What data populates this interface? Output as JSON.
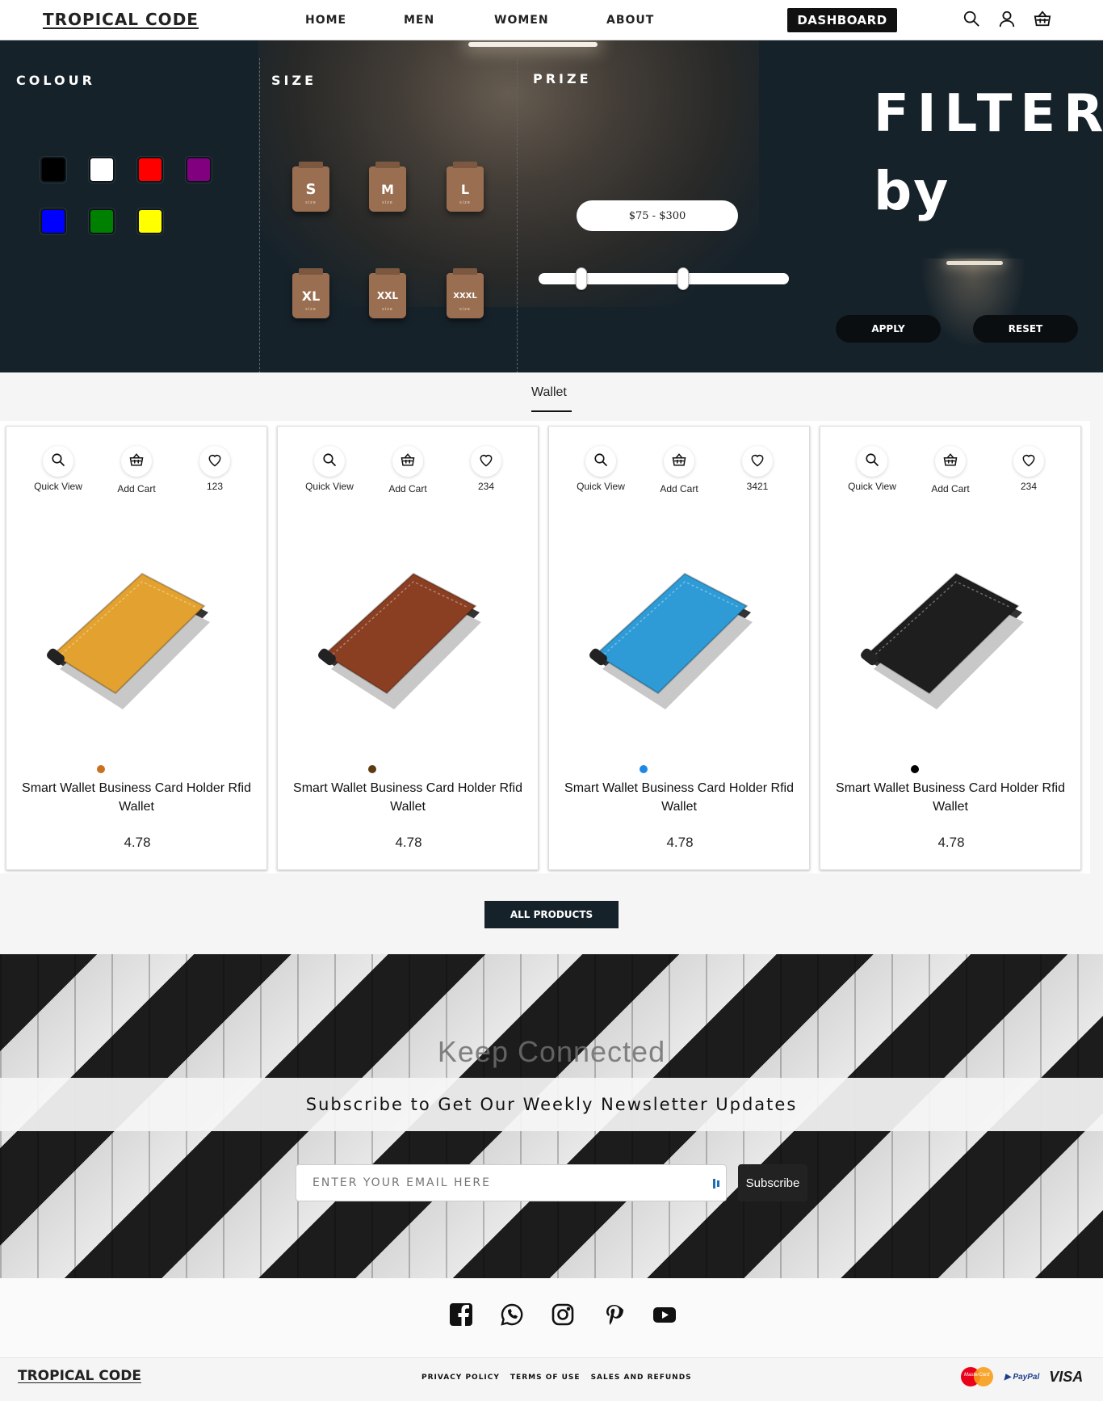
{
  "header": {
    "logo": "TROPICAL CODE",
    "nav": [
      "HOME",
      "MEN",
      "WOMEN",
      "ABOUT"
    ],
    "dashboard_label": "DASHBOARD",
    "icons": [
      "search-icon",
      "user-icon",
      "basket-icon"
    ]
  },
  "filter": {
    "colour_title": "COLOUR",
    "size_title": "SIZE",
    "prize_title": "PRIZE",
    "colours": [
      "#000000",
      "#ffffff",
      "#ff0000",
      "#800080",
      "#0000ff",
      "#008000",
      "#ffff00"
    ],
    "sizes": [
      "S",
      "M",
      "L",
      "XL",
      "XXL",
      "XXXL"
    ],
    "price_range": "$75 - $300",
    "heading_line1": "FILTER",
    "heading_line2": "by",
    "apply_label": "APPLY",
    "reset_label": "RESET"
  },
  "category": {
    "active": "Wallet"
  },
  "products": [
    {
      "quick_view": "Quick View",
      "add_cart": "Add Cart",
      "likes": "123",
      "title": "Smart Wallet Business Card Holder Rfid Wallet",
      "price": "4.78",
      "color": "#c9711f",
      "wallet_color": "#e3a22f"
    },
    {
      "quick_view": "Quick View",
      "add_cart": "Add Cart",
      "likes": "234",
      "title": "Smart Wallet Business Card Holder Rfid Wallet",
      "price": "4.78",
      "color": "#5c3a12",
      "wallet_color": "#8a3f22"
    },
    {
      "quick_view": "Quick View",
      "add_cart": "Add Cart",
      "likes": "3421",
      "title": "Smart Wallet Business Card Holder Rfid Wallet",
      "price": "4.78",
      "color": "#1e88e5",
      "wallet_color": "#2e9bd6"
    },
    {
      "quick_view": "Quick View",
      "add_cart": "Add Cart",
      "likes": "234",
      "title": "Smart Wallet Business Card Holder Rfid Wallet",
      "price": "4.78",
      "color": "#000000",
      "wallet_color": "#1e1e1e"
    }
  ],
  "all_products_label": "ALL PRODUCTS",
  "newsletter": {
    "title": "Keep Connected",
    "subtitle": "Subscribe to Get Our Weekly Newsletter Updates",
    "email_placeholder": "ENTER YOUR EMAIL HERE",
    "subscribe_label": "Subscribe"
  },
  "social_icons": [
    "facebook-icon",
    "whatsapp-icon",
    "instagram-icon",
    "pinterest-icon",
    "youtube-icon"
  ],
  "footer": {
    "logo": "TROPICAL CODE",
    "links": [
      "PRIVACY POLICY",
      "TERMS OF USE",
      "SALES AND REFUNDS"
    ],
    "payments": {
      "mastercard": "MasterCard",
      "paypal": "PayPal",
      "visa": "VISA"
    }
  }
}
